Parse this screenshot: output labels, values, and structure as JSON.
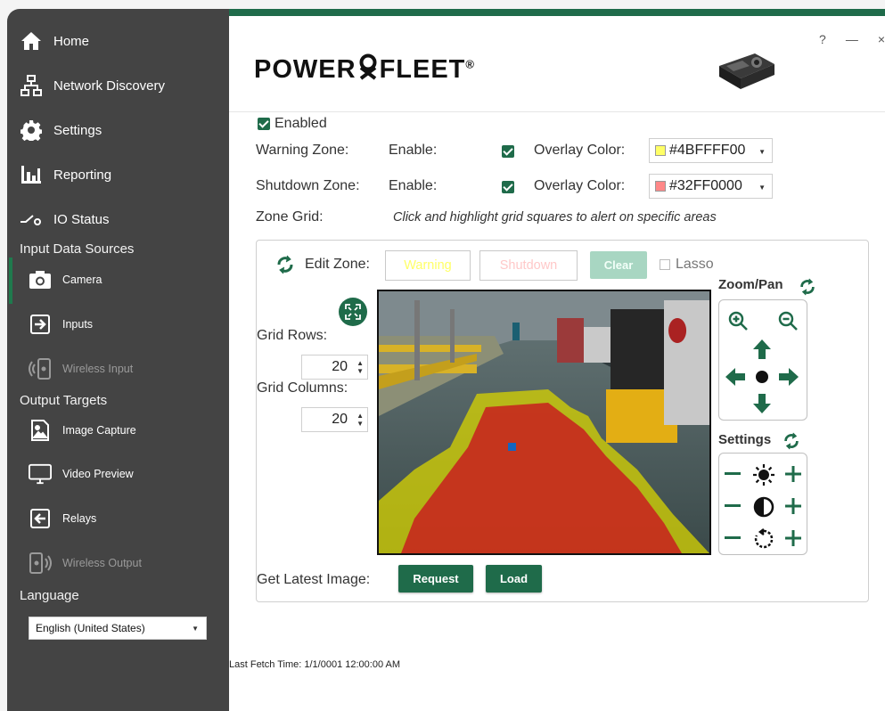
{
  "sidebar": {
    "nav": [
      {
        "label": "Home",
        "icon": "home-icon"
      },
      {
        "label": "Network Discovery",
        "icon": "network-icon"
      },
      {
        "label": "Settings",
        "icon": "gear-icon"
      },
      {
        "label": "Reporting",
        "icon": "bar-chart-icon"
      },
      {
        "label": "IO Status",
        "icon": "switch-icon"
      }
    ],
    "input_sources_label": "Input Data Sources",
    "inputs": [
      {
        "label": "Camera",
        "icon": "camera-icon",
        "active": true
      },
      {
        "label": "Inputs",
        "icon": "input-arrow-icon"
      },
      {
        "label": "Wireless Input",
        "icon": "wireless-input-icon",
        "disabled": true
      }
    ],
    "output_targets_label": "Output Targets",
    "outputs": [
      {
        "label": "Image Capture",
        "icon": "image-icon"
      },
      {
        "label": "Video Preview",
        "icon": "monitor-icon"
      },
      {
        "label": "Relays",
        "icon": "relay-arrow-icon"
      },
      {
        "label": "Wireless Output",
        "icon": "wireless-output-icon",
        "disabled": true
      }
    ],
    "language_label": "Language",
    "language_value": "English (United States)"
  },
  "header": {
    "logo_left": "POWER",
    "logo_right": "FLEET",
    "logo_reg": "®",
    "help": "?",
    "minimize": "—",
    "close": "×"
  },
  "form": {
    "enabled_label": "Enabled",
    "warning_zone_label": "Warning Zone:",
    "shutdown_zone_label": "Shutdown Zone:",
    "enable_label": "Enable:",
    "overlay_color_label": "Overlay Color:",
    "warning_color": "#4BFFFF00",
    "shutdown_color": "#32FF0000",
    "zone_grid_label": "Zone Grid:",
    "zone_grid_hint": "Click and highlight grid squares to alert on specific areas"
  },
  "zone_panel": {
    "edit_zone_label": "Edit Zone:",
    "warning_btn": "Warning",
    "shutdown_btn": "Shutdown",
    "clear_btn": "Clear",
    "lasso_label": "Lasso",
    "grid_rows_label": "Grid Rows:",
    "grid_rows_value": "20",
    "grid_columns_label": "Grid Columns:",
    "grid_columns_value": "20",
    "zoom_pan_label": "Zoom/Pan",
    "settings_label": "Settings",
    "get_latest_label": "Get Latest Image:",
    "request_btn": "Request",
    "load_btn": "Load"
  },
  "footer": {
    "last_fetch": "Last Fetch Time: 1/1/0001 12:00:00 AM"
  },
  "colors": {
    "accent": "#1f6b4a",
    "sidebar_bg": "#444444",
    "warning_swatch": "#ffff00",
    "shutdown_swatch": "#ff0000"
  }
}
